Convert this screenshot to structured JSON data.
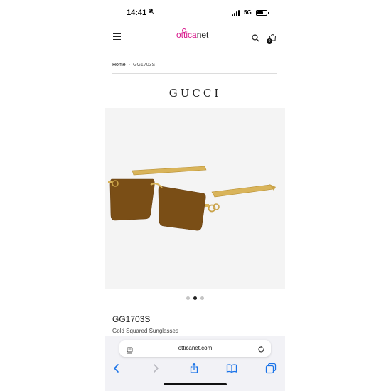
{
  "status_bar": {
    "time": "14:41",
    "network": "5G",
    "bell_icon": "bell-slash-icon",
    "signal_icon": "signal-icon",
    "battery_icon": "battery-icon",
    "battery_level": 0.7
  },
  "header": {
    "menu_icon": "hamburger-menu-icon",
    "logo_prefix": "ottica",
    "logo_suffix": "net",
    "search_icon": "search-icon",
    "cart_icon": "shopping-bag-icon",
    "cart_count": "0",
    "brand_color": "#d8188c"
  },
  "breadcrumb": {
    "home": "Home",
    "separator": "›",
    "current": "GG1703S"
  },
  "brand": "GUCCI",
  "gallery": {
    "active_index": 1,
    "dots": 3
  },
  "product": {
    "name": "GG1703S",
    "description": "Gold Squared Sunglasses"
  },
  "browser": {
    "url": "otticanet.com",
    "page_icon": "page-settings-icon",
    "reload_icon": "reload-icon",
    "nav": {
      "back_icon": "chevron-left-icon",
      "forward_icon": "chevron-right-icon",
      "share_icon": "share-icon",
      "bookmarks_icon": "book-icon",
      "tabs_icon": "tabs-icon"
    },
    "accent_color": "#1a73e8"
  }
}
